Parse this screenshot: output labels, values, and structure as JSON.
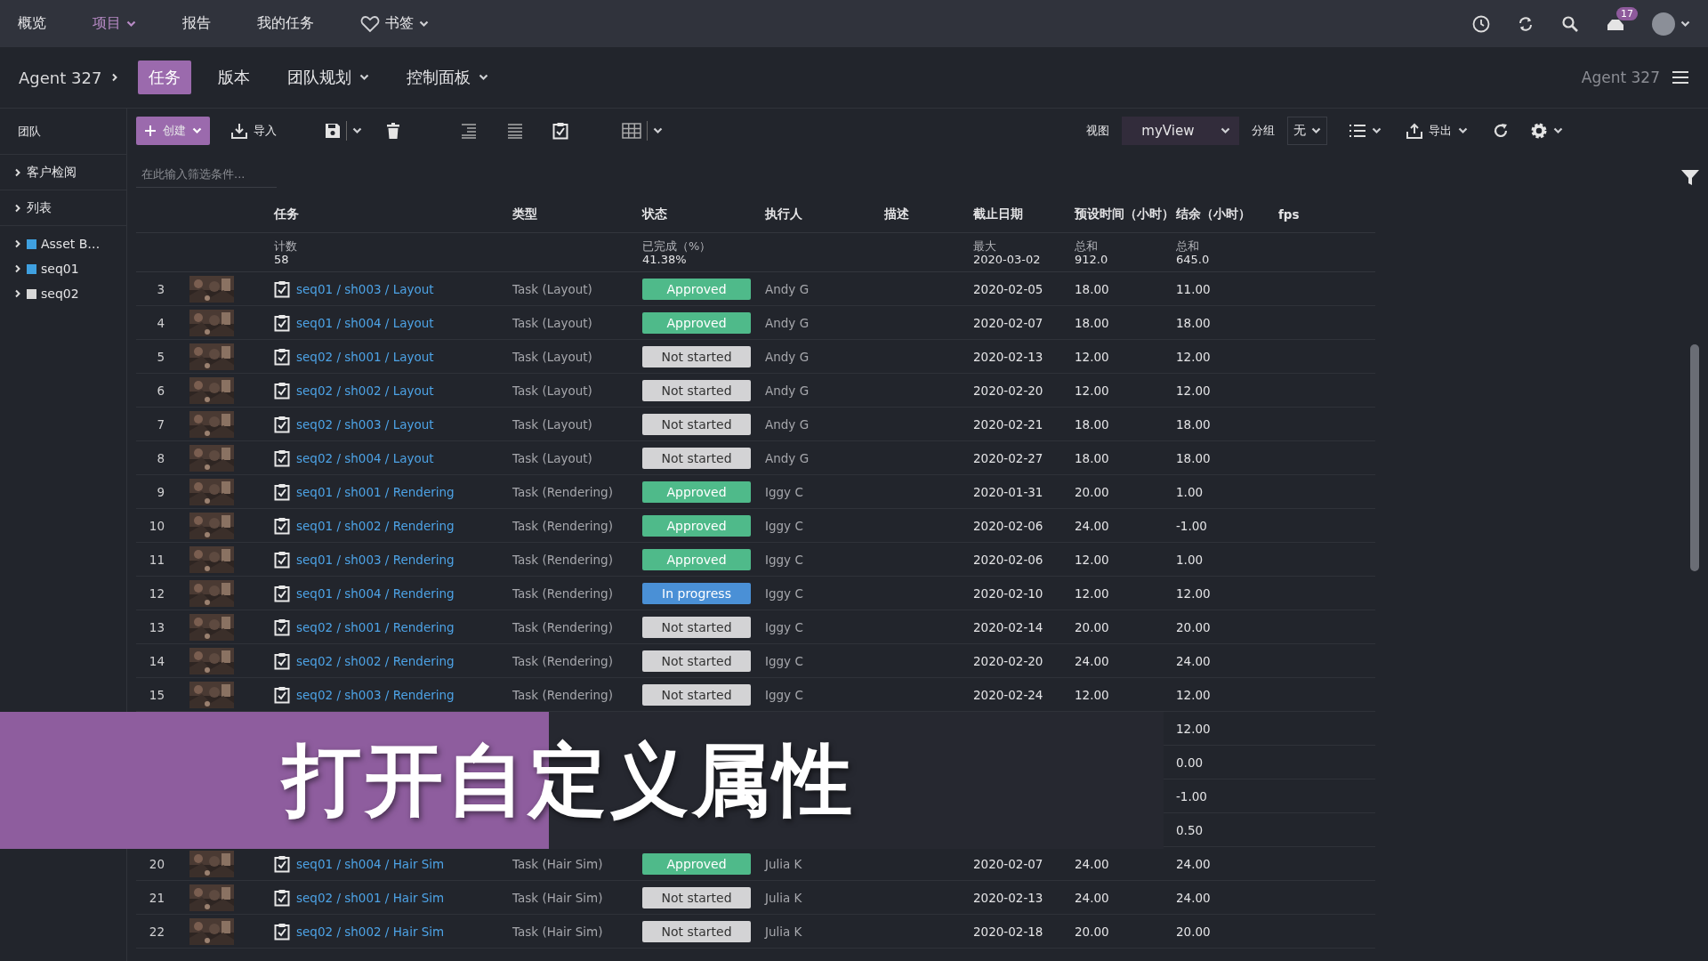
{
  "top_nav": {
    "items": [
      {
        "label": "概览",
        "selected": false,
        "dropdown": false,
        "kind": "link"
      },
      {
        "label": "项目",
        "selected": true,
        "dropdown": true,
        "kind": "link"
      },
      {
        "label": "报告",
        "selected": false,
        "dropdown": false,
        "kind": "link"
      },
      {
        "label": "我的任务",
        "selected": false,
        "dropdown": false,
        "kind": "link"
      },
      {
        "label": "书签",
        "selected": false,
        "dropdown": true,
        "kind": "bookmarks"
      }
    ],
    "notification_count": "17"
  },
  "project_bar": {
    "name": "Agent 327",
    "tabs": [
      {
        "label": "任务",
        "selected": true,
        "dropdown": false
      },
      {
        "label": "版本",
        "selected": false,
        "dropdown": false
      },
      {
        "label": "团队规划",
        "selected": false,
        "dropdown": true
      },
      {
        "label": "控制面板",
        "selected": false,
        "dropdown": true
      }
    ],
    "right_label": "Agent 327"
  },
  "sidebar": {
    "heading": "团队",
    "sections": [
      {
        "label": "客户检阅",
        "expanded": false
      },
      {
        "label": "列表",
        "expanded": false
      }
    ],
    "tree": [
      {
        "label": "Asset B…",
        "color": "#3fa0e0",
        "expanded": false
      },
      {
        "label": "seq01",
        "color": "#3fa0e0",
        "expanded": false
      },
      {
        "label": "seq02",
        "color": "#d8d8d8",
        "expanded": false
      }
    ]
  },
  "toolbar": {
    "create": "创建",
    "import": "导入",
    "view_label": "视图",
    "view": "myView",
    "group_label": "分组",
    "group": "无",
    "export": "导出"
  },
  "filter": {
    "placeholder": "在此输入筛选条件..."
  },
  "table": {
    "columns": [
      "任务",
      "类型",
      "状态",
      "执行人",
      "描述",
      "截止日期",
      "预设时间（小时）",
      "结余（小时）",
      "fps"
    ],
    "summary": {
      "task": {
        "label": "计数",
        "value": "58"
      },
      "status": {
        "label": "已完成（%）",
        "value": "41.38%"
      },
      "due_date": {
        "label": "最大",
        "value": "2020-03-02"
      },
      "estimate": {
        "label": "总和",
        "value": "912.0"
      },
      "remaining": {
        "label": "总和",
        "value": "645.0"
      }
    },
    "rows": [
      {
        "number": "3",
        "task": "seq01 / sh003 / Layout",
        "type": "Task (Layout)",
        "status": {
          "label": "Approved",
          "color": "#4fba8a"
        },
        "assignee": "Andy G",
        "due_date": "2020-02-05",
        "estimate": "18.00",
        "remaining": "11.00"
      },
      {
        "number": "4",
        "task": "seq01 / sh004 / Layout",
        "type": "Task (Layout)",
        "status": {
          "label": "Approved",
          "color": "#4fba8a"
        },
        "assignee": "Andy G",
        "due_date": "2020-02-07",
        "estimate": "18.00",
        "remaining": "18.00"
      },
      {
        "number": "5",
        "task": "seq02 / sh001 / Layout",
        "type": "Task (Layout)",
        "status": {
          "label": "Not started",
          "color": "#d3d3d5"
        },
        "assignee": "Andy G",
        "due_date": "2020-02-13",
        "estimate": "12.00",
        "remaining": "12.00"
      },
      {
        "number": "6",
        "task": "seq02 / sh002 / Layout",
        "type": "Task (Layout)",
        "status": {
          "label": "Not started",
          "color": "#d3d3d5"
        },
        "assignee": "Andy G",
        "due_date": "2020-02-20",
        "estimate": "12.00",
        "remaining": "12.00"
      },
      {
        "number": "7",
        "task": "seq02 / sh003 / Layout",
        "type": "Task (Layout)",
        "status": {
          "label": "Not started",
          "color": "#d3d3d5"
        },
        "assignee": "Andy G",
        "due_date": "2020-02-21",
        "estimate": "18.00",
        "remaining": "18.00"
      },
      {
        "number": "8",
        "task": "seq02 / sh004 / Layout",
        "type": "Task (Layout)",
        "status": {
          "label": "Not started",
          "color": "#d3d3d5"
        },
        "assignee": "Andy G",
        "due_date": "2020-02-27",
        "estimate": "18.00",
        "remaining": "18.00"
      },
      {
        "number": "9",
        "task": "seq01 / sh001 / Rendering",
        "type": "Task (Rendering)",
        "status": {
          "label": "Approved",
          "color": "#4fba8a"
        },
        "assignee": "Iggy C",
        "due_date": "2020-01-31",
        "estimate": "20.00",
        "remaining": "1.00"
      },
      {
        "number": "10",
        "task": "seq01 / sh002 / Rendering",
        "type": "Task (Rendering)",
        "status": {
          "label": "Approved",
          "color": "#4fba8a"
        },
        "assignee": "Iggy C",
        "due_date": "2020-02-06",
        "estimate": "24.00",
        "remaining": "-1.00"
      },
      {
        "number": "11",
        "task": "seq01 / sh003 / Rendering",
        "type": "Task (Rendering)",
        "status": {
          "label": "Approved",
          "color": "#4fba8a"
        },
        "assignee": "Iggy C",
        "due_date": "2020-02-06",
        "estimate": "12.00",
        "remaining": "1.00"
      },
      {
        "number": "12",
        "task": "seq01 / sh004 / Rendering",
        "type": "Task (Rendering)",
        "status": {
          "label": "In progress",
          "color": "#4a90d6"
        },
        "assignee": "Iggy C",
        "due_date": "2020-02-10",
        "estimate": "12.00",
        "remaining": "12.00"
      },
      {
        "number": "13",
        "task": "seq02 / sh001 / Rendering",
        "type": "Task (Rendering)",
        "status": {
          "label": "Not started",
          "color": "#d3d3d5"
        },
        "assignee": "Iggy C",
        "due_date": "2020-02-14",
        "estimate": "20.00",
        "remaining": "20.00"
      },
      {
        "number": "14",
        "task": "seq02 / sh002 / Rendering",
        "type": "Task (Rendering)",
        "status": {
          "label": "Not started",
          "color": "#d3d3d5"
        },
        "assignee": "Iggy C",
        "due_date": "2020-02-20",
        "estimate": "24.00",
        "remaining": "24.00"
      },
      {
        "number": "15",
        "task": "seq02 / sh003 / Rendering",
        "type": "Task (Rendering)",
        "status": {
          "label": "Not started",
          "color": "#d3d3d5"
        },
        "assignee": "Iggy C",
        "due_date": "2020-02-24",
        "estimate": "12.00",
        "remaining": "12.00"
      }
    ],
    "covered_rows": [
      {
        "remaining": "12.00"
      },
      {
        "remaining": "0.00"
      },
      {
        "remaining": "-1.00"
      },
      {
        "remaining": "0.50"
      }
    ],
    "rows_below": [
      {
        "number": "20",
        "task": "seq01 / sh004 / Hair Sim",
        "type": "Task (Hair Sim)",
        "status": {
          "label": "Approved",
          "color": "#4fba8a"
        },
        "assignee": "Julia K",
        "due_date": "2020-02-07",
        "estimate": "24.00",
        "remaining": "24.00"
      },
      {
        "number": "21",
        "task": "seq02 / sh001 / Hair Sim",
        "type": "Task (Hair Sim)",
        "status": {
          "label": "Not started",
          "color": "#d3d3d5"
        },
        "assignee": "Julia K",
        "due_date": "2020-02-13",
        "estimate": "24.00",
        "remaining": "24.00"
      },
      {
        "number": "22",
        "task": "seq02 / sh002 / Hair Sim",
        "type": "Task (Hair Sim)",
        "status": {
          "label": "Not started",
          "color": "#d3d3d5"
        },
        "assignee": "Julia K",
        "due_date": "2020-02-18",
        "estimate": "20.00",
        "remaining": "20.00"
      }
    ]
  },
  "caption": "打开自定义属性"
}
